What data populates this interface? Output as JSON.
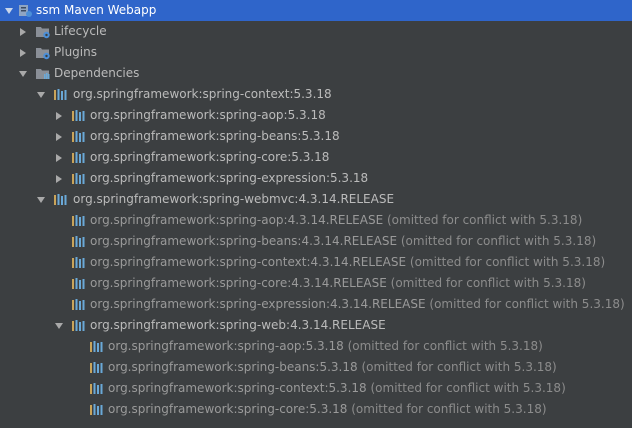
{
  "tree": {
    "root": {
      "label": "ssm Maven Webapp"
    },
    "lifecycle": {
      "label": "Lifecycle"
    },
    "plugins": {
      "label": "Plugins"
    },
    "dependencies": {
      "label": "Dependencies"
    },
    "nodes": [
      {
        "label": "org.springframework:spring-context:5.3.18",
        "note": ""
      },
      {
        "label": "org.springframework:spring-aop:5.3.18",
        "note": ""
      },
      {
        "label": "org.springframework:spring-beans:5.3.18",
        "note": ""
      },
      {
        "label": "org.springframework:spring-core:5.3.18",
        "note": ""
      },
      {
        "label": "org.springframework:spring-expression:5.3.18",
        "note": ""
      },
      {
        "label": "org.springframework:spring-webmvc:4.3.14.RELEASE",
        "note": ""
      },
      {
        "label": "org.springframework:spring-aop:4.3.14.RELEASE",
        "note": "(omitted for conflict with 5.3.18)"
      },
      {
        "label": "org.springframework:spring-beans:4.3.14.RELEASE",
        "note": "(omitted for conflict with 5.3.18)"
      },
      {
        "label": "org.springframework:spring-context:4.3.14.RELEASE",
        "note": "(omitted for conflict with 5.3.18)"
      },
      {
        "label": "org.springframework:spring-core:4.3.14.RELEASE",
        "note": "(omitted for conflict with 5.3.18)"
      },
      {
        "label": "org.springframework:spring-expression:4.3.14.RELEASE",
        "note": "(omitted for conflict with 5.3.18)"
      },
      {
        "label": "org.springframework:spring-web:4.3.14.RELEASE",
        "note": ""
      },
      {
        "label": "org.springframework:spring-aop:5.3.18",
        "note": "(omitted for conflict with 5.3.18)"
      },
      {
        "label": "org.springframework:spring-beans:5.3.18",
        "note": "(omitted for conflict with 5.3.18)"
      },
      {
        "label": "org.springframework:spring-context:5.3.18",
        "note": "(omitted for conflict with 5.3.18)"
      },
      {
        "label": "org.springframework:spring-core:5.3.18",
        "note": "(omitted for conflict with 5.3.18)"
      }
    ]
  },
  "colors": {
    "background": "#3c3f41",
    "selection": "#2f65ca",
    "text": "#bbbbbb",
    "omitted": "#8c8c8c",
    "library_icon": "#6aa9d8"
  },
  "icons": {
    "expanded": "triangle-down-icon",
    "collapsed": "triangle-right-icon",
    "module": "maven-module-icon",
    "folder": "maven-folder-icon",
    "library": "library-bars-icon"
  }
}
